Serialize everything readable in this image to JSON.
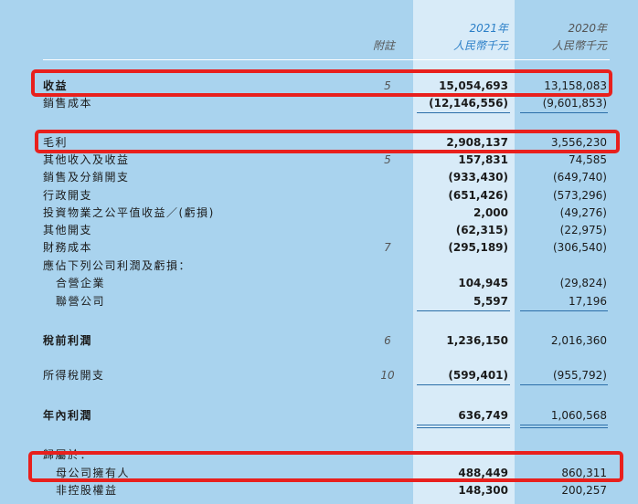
{
  "header": {
    "note": "附註",
    "year_2021": "2021年",
    "unit_2021": "人民幣千元",
    "year_2020": "2020年",
    "unit_2020": "人民幣千元"
  },
  "rows": [
    {
      "label": "收益",
      "note": "5",
      "v2021": "15,054,693",
      "v2020": "13,158,083"
    },
    {
      "label": "銷售成本",
      "note": "",
      "v2021": "(12,146,556)",
      "v2020": "(9,601,853)"
    },
    {
      "label": "毛利",
      "note": "",
      "v2021": "2,908,137",
      "v2020": "3,556,230"
    },
    {
      "label": "其他收入及收益",
      "note": "5",
      "v2021": "157,831",
      "v2020": "74,585"
    },
    {
      "label": "銷售及分銷開支",
      "note": "",
      "v2021": "(933,430)",
      "v2020": "(649,740)"
    },
    {
      "label": "行政開支",
      "note": "",
      "v2021": "(651,426)",
      "v2020": "(573,296)"
    },
    {
      "label": "投資物業之公平值收益／(虧損)",
      "note": "",
      "v2021": "2,000",
      "v2020": "(49,276)"
    },
    {
      "label": "其他開支",
      "note": "",
      "v2021": "(62,315)",
      "v2020": "(22,975)"
    },
    {
      "label": "財務成本",
      "note": "7",
      "v2021": "(295,189)",
      "v2020": "(306,540)"
    },
    {
      "label": "應佔下列公司利潤及虧損：",
      "note": "",
      "v2021": "",
      "v2020": ""
    },
    {
      "label": "合營企業",
      "note": "",
      "v2021": "104,945",
      "v2020": "(29,824)"
    },
    {
      "label": "聯營公司",
      "note": "",
      "v2021": "5,597",
      "v2020": "17,196"
    },
    {
      "label": "稅前利潤",
      "note": "6",
      "v2021": "1,236,150",
      "v2020": "2,016,360"
    },
    {
      "label": "所得稅開支",
      "note": "10",
      "v2021": "(599,401)",
      "v2020": "(955,792)"
    },
    {
      "label": "年內利潤",
      "note": "",
      "v2021": "636,749",
      "v2020": "1,060,568"
    },
    {
      "label": "歸屬於：",
      "note": "",
      "v2021": "",
      "v2020": ""
    },
    {
      "label": "母公司擁有人",
      "note": "",
      "v2021": "488,449",
      "v2020": "860,311"
    },
    {
      "label": "非控股權益",
      "note": "",
      "v2021": "148,300",
      "v2020": "200,257"
    }
  ]
}
